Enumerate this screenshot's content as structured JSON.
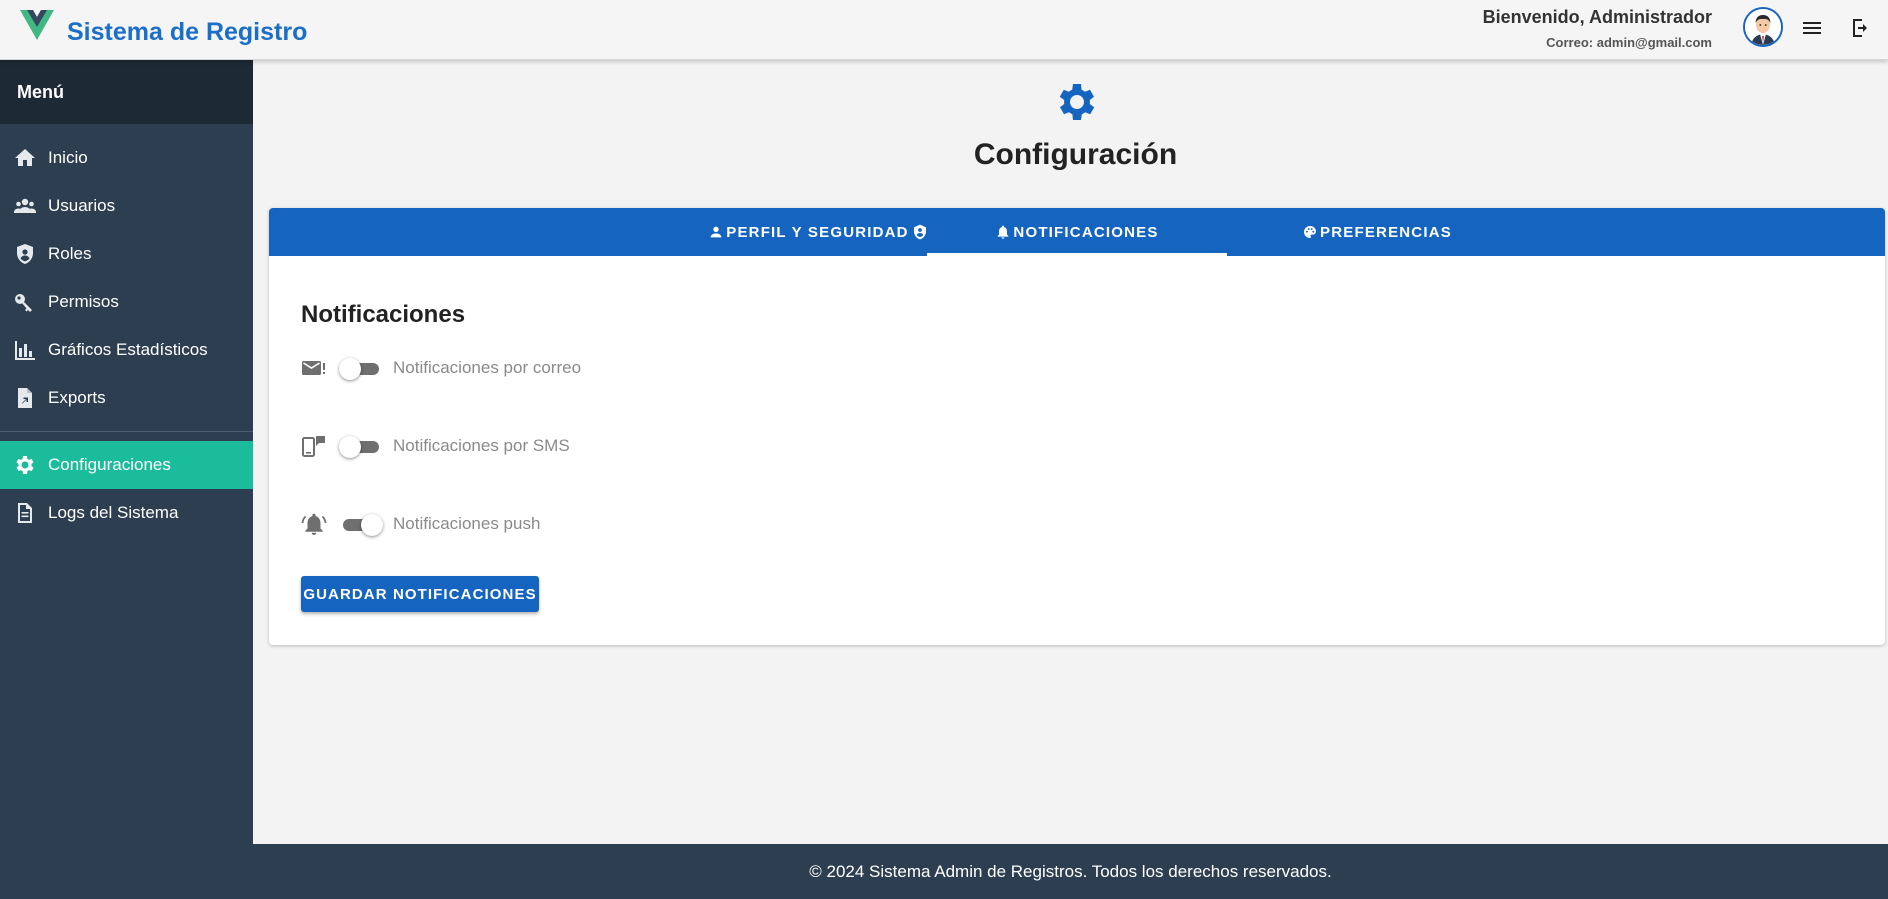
{
  "header": {
    "app_title": "Sistema de Registro",
    "welcome": "Bienvenido, Administrador",
    "email": "Correo: admin@gmail.com",
    "brand_color": "#1b6fc8"
  },
  "sidebar": {
    "title": "Menú",
    "items": [
      {
        "label": "Inicio",
        "icon": "home-icon"
      },
      {
        "label": "Usuarios",
        "icon": "users-icon"
      },
      {
        "label": "Roles",
        "icon": "shield-icon"
      },
      {
        "label": "Permisos",
        "icon": "key-icon"
      },
      {
        "label": "Gráficos Estadísticos",
        "icon": "bar-chart-icon"
      },
      {
        "label": "Exports",
        "icon": "file-export-icon"
      },
      {
        "label": "Configuraciones",
        "icon": "gear-icon",
        "active": true
      },
      {
        "label": "Logs del Sistema",
        "icon": "document-icon"
      }
    ],
    "bg_color": "#2c3e50",
    "active_color": "#1abc9c"
  },
  "main": {
    "title": "Configuración",
    "tabs": [
      {
        "label": "PERFIL Y SEGURIDAD",
        "icon": "person-icon"
      },
      {
        "label": "NOTIFICACIONES",
        "icon": "bell-icon",
        "active": true
      },
      {
        "label": "PREFERENCIAS",
        "icon": "palette-icon"
      }
    ],
    "section_title": "Notificaciones",
    "notifications": [
      {
        "label": "Notificaciones por correo",
        "icon": "email-alert-icon",
        "enabled": false
      },
      {
        "label": "Notificaciones por SMS",
        "icon": "cellphone-message-icon",
        "enabled": false
      },
      {
        "label": "Notificaciones push",
        "icon": "bell-ring-icon",
        "enabled": true
      }
    ],
    "save_label": "GUARDAR NOTIFICACIONES",
    "accent_color": "#1565c0"
  },
  "footer": {
    "text": "© 2024 Sistema Admin de Registros. Todos los derechos reservados."
  }
}
